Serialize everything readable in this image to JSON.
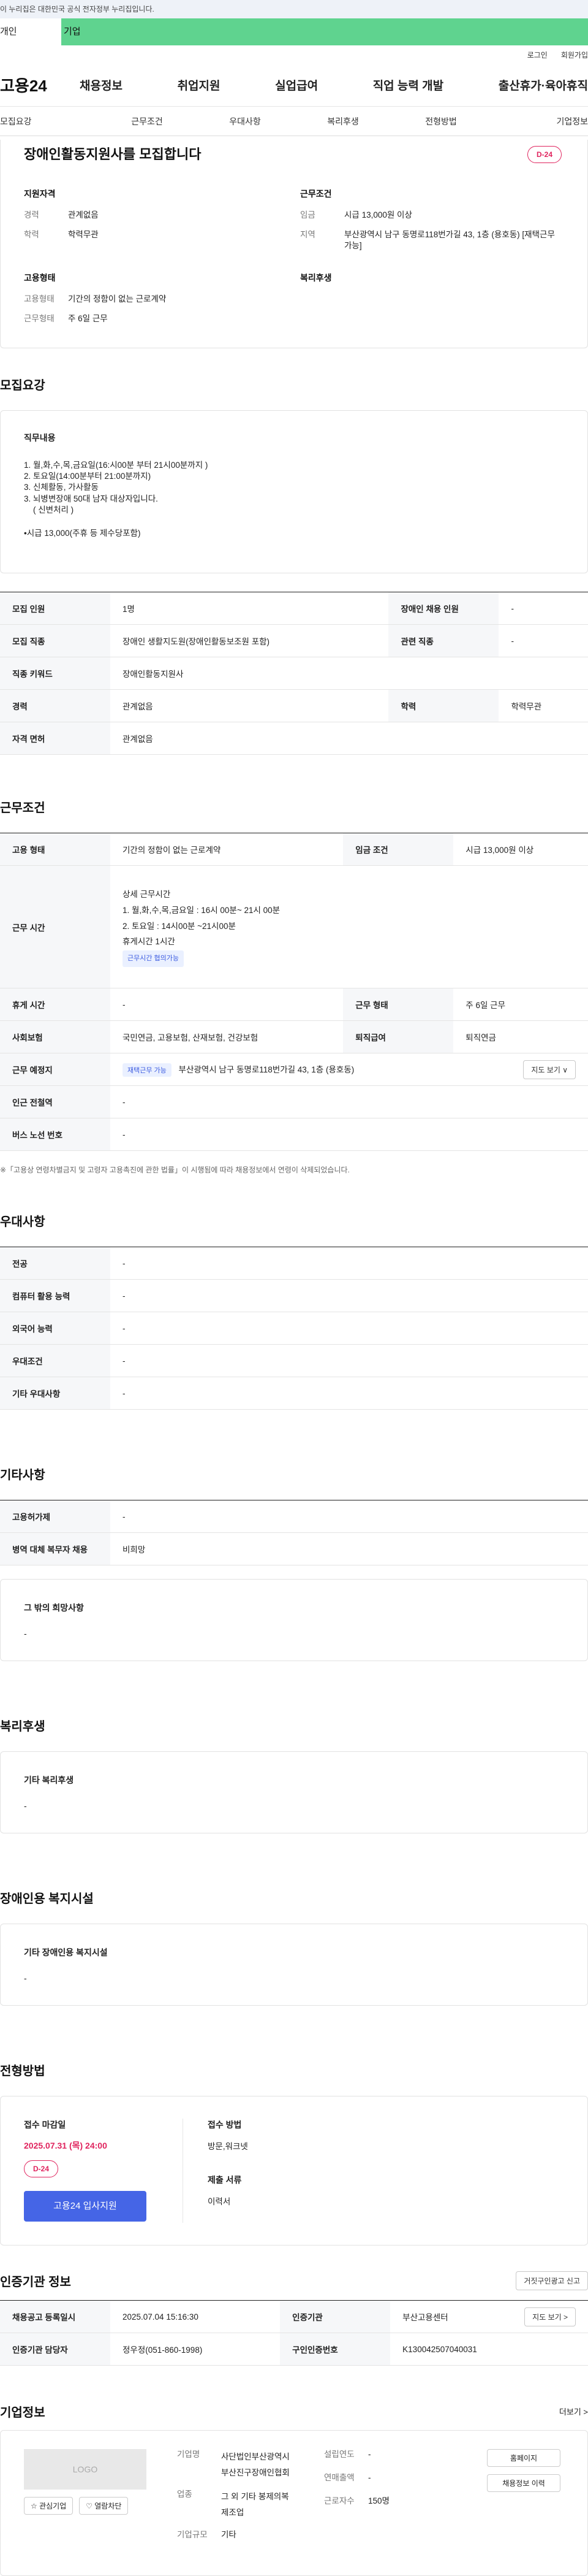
{
  "gov_banner": "이 누리집은 대한민국 공식 전자정부 누리집입니다.",
  "top_tabs": [
    "개인",
    "기업"
  ],
  "util": [
    "로그인",
    "회원가입"
  ],
  "logo": "고용24",
  "gnb": [
    "채용정보",
    "취업지원",
    "실업급여",
    "직업 능력 개발",
    "출산휴가·육아휴직"
  ],
  "subtabs": [
    "모집요강",
    "근무조건",
    "우대사항",
    "복리후생",
    "전형방법",
    "기업정보"
  ],
  "summary": {
    "title": "장애인활동지원사를 모집합니다",
    "dday": "D-24",
    "qual_title": "지원자격",
    "qual": [
      {
        "k": "경력",
        "v": "관계없음"
      },
      {
        "k": "학력",
        "v": "학력무관"
      }
    ],
    "cond_title": "근무조건",
    "cond": [
      {
        "k": "임금",
        "v": "시급 13,000원 이상"
      },
      {
        "k": "지역",
        "v": "부산광역시 남구 동명로118번가길 43, 1층 (용호동) [재택근무 가능]"
      }
    ],
    "type_title": "고용형태",
    "type": [
      {
        "k": "고용형태",
        "v": "기간의 정함이 없는 근로계약"
      },
      {
        "k": "근무형태",
        "v": "주 6일 근무"
      }
    ],
    "welfare_title": "복리후생"
  },
  "recruit": {
    "section_title": "모집요강",
    "duty_title": "직무내용",
    "duty_lines": [
      "1. 월,화,수,목,금요일(16:시00분 부터 21시00분까지 )",
      "2. 토요일(14:00분부터 21:00분까지)",
      "3. 신체활동, 가사활동",
      "3. 뇌병변장애 50대 남자 대상자입니다.",
      "    ( 신변처리 )",
      "",
      "•시급 13,000(주휴 등 제수당포함)"
    ],
    "rows": [
      [
        "모집 인원",
        "1명",
        "장애인 채용 인원",
        "-"
      ],
      [
        "모집 직종",
        "장애인 생활지도원(장애인활동보조원 포함)",
        "관련 직종",
        "-"
      ],
      [
        "직종 키워드",
        "장애인활동지원사"
      ],
      [
        "경력",
        "관계없음",
        "학력",
        "학력무관"
      ],
      [
        "자격 면허",
        "관계없음"
      ]
    ]
  },
  "work": {
    "section_title": "근무조건",
    "employ_label": "고용 형태",
    "employ_value": "기간의 정함이 없는 근로계약",
    "wage_label": "임금 조건",
    "wage_value": "시급 13,000원 이상",
    "time_label": "근무 시간",
    "time_lines": [
      "상세 근무시간",
      "1. 월,화,수,목,금요일 : 16시 00분~ 21시 00분",
      "2. 토요일 : 14시00분 ~21시00분",
      "휴게시간 1시간"
    ],
    "time_tag": "근무시간 협의가능",
    "break_label": "휴게 시간",
    "break_value": "-",
    "form_label": "근무 형태",
    "form_value": "주 6일 근무",
    "insurance_label": "사회보험",
    "insurance_value": "국민연금, 고용보험, 산재보험, 건강보험",
    "pension_label": "퇴직급여",
    "pension_value": "퇴직연금",
    "place_label": "근무 예정지",
    "place_tag": "재택근무 가능",
    "place_value": "부산광역시 남구 동명로118번가길 43, 1층 (용호동)",
    "map_btn": "지도 보기 ∨",
    "subway_label": "인근 전철역",
    "subway_value": "-",
    "bus_label": "버스 노선 번호",
    "bus_value": "-",
    "note": "※「고용상 연령차별금지 및 고령자 고용촉진에 관한 법률」이 시행됨에 따라 채용정보에서 연령이 삭제되었습니다."
  },
  "pref": {
    "section_title": "우대사항",
    "rows": [
      [
        "전공",
        "-"
      ],
      [
        "컴퓨터 활용 능력",
        "-"
      ],
      [
        "외국어 능력",
        "-"
      ],
      [
        "우대조건",
        "-"
      ],
      [
        "기타 우대사항",
        "-"
      ]
    ]
  },
  "etc": {
    "section_title": "기타사항",
    "rows": [
      [
        "고용허가제",
        "-"
      ],
      [
        "병역 대체 복무자 채용",
        "비희망"
      ]
    ],
    "other_title": "그 밖의 희망사항",
    "other_value": "-"
  },
  "welfare": {
    "section_title": "복리후생",
    "card_title": "기타 복리후생",
    "value": "-"
  },
  "disability": {
    "section_title": "장애인용 복지시설",
    "card_title": "기타 장애인용 복지시설",
    "value": "-"
  },
  "method": {
    "section_title": "전형방법",
    "deadline_title": "접수 마감일",
    "deadline": "2025.07.31 (목) 24:00",
    "dday": "D-24",
    "apply_btn": "고용24 입사지원",
    "how_title": "접수 방법",
    "how_value": "방문,워크넷",
    "docs_title": "제출 서류",
    "docs_value": "이력서"
  },
  "cert": {
    "section_title": "인증기관 정보",
    "report_btn": "거짓구인광고 신고",
    "reg_label": "채용공고 등록일시",
    "reg_value": "2025.07.04 15:16:30",
    "org_label": "인증기관",
    "org_value": "부산고용센터",
    "map_btn": "지도 보기 >",
    "mgr_label": "인증기관 담당자",
    "mgr_value": "정우정(051-860-1998)",
    "no_label": "구인인증번호",
    "no_value": "K130042507040031"
  },
  "company": {
    "section_title": "기업정보",
    "more": "더보기 >",
    "logo": "LOGO",
    "fav_btn": "☆ 관심기업",
    "block_btn": "♡ 열람차단",
    "name_label": "기업명",
    "name_value": "사단법인부산광역시부산진구장애인협회",
    "industry_label": "업종",
    "industry_value": "그 외 기타 봉제의복 제조업",
    "size_label": "기업규모",
    "size_value": "기타",
    "year_label": "설립연도",
    "year_value": "-",
    "sales_label": "연매출액",
    "sales_value": "-",
    "staff_label": "근로자수",
    "staff_value": "150명",
    "home_btn": "홈페이지",
    "recruit_btn": "채용정보 이력"
  }
}
